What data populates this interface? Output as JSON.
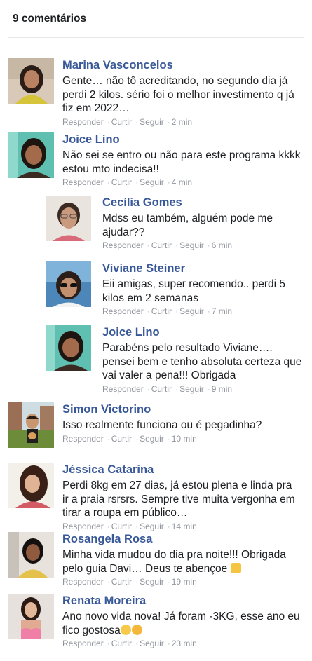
{
  "header": {
    "title": "9 comentários"
  },
  "actions": {
    "reply": "Responder",
    "like": "Curtir",
    "follow": "Seguir"
  },
  "comments": [
    {
      "name": "Marina Vasconcelos",
      "text": "Gente… não tô acreditando, no segundo dia já perdi 2 kilos. sério foi o melhor investimento q já fiz em 2022…",
      "time": "2 min"
    },
    {
      "name": "Joice Lino",
      "text": "Não sei se entro ou não para este programa kkkk estou mto indecisa!!",
      "time": "4 min"
    },
    {
      "name": "Cecília Gomes",
      "text": "Mdss eu também, alguém pode me ajudar??",
      "time": "6 min"
    },
    {
      "name": "Viviane Steiner",
      "text": "Eii amigas, super recomendo.. perdi 5 kilos em 2 semanas",
      "time": "7 min"
    },
    {
      "name": "Joice Lino",
      "text": "Parabéns pelo resultado Viviane…. pensei bem e tenho absoluta certeza que vai valer a pena!!! Obrigada",
      "time": "9 min"
    },
    {
      "name": "Simon Victorino",
      "text": "Isso realmente funciona ou é pegadinha?",
      "time": "10 min"
    },
    {
      "name": "Jéssica Catarina",
      "text": "Perdi 8kg em 27 dias, já estou plena e linda pra ir a praia rsrsrs. Sempre tive muita vergonha em tirar a roupa em público…",
      "time": "14 min"
    },
    {
      "name": "Rosangela Rosa",
      "text": "Minha vida mudou do dia pra noite!!! Obrigada pelo guia Davi… Deus te abençoe",
      "time": "19 min"
    },
    {
      "name": "Renata Moreira",
      "text": "Ano novo vida nova! Já foram -3KG, esse ano eu fico gostosa",
      "time": "23 min"
    }
  ]
}
